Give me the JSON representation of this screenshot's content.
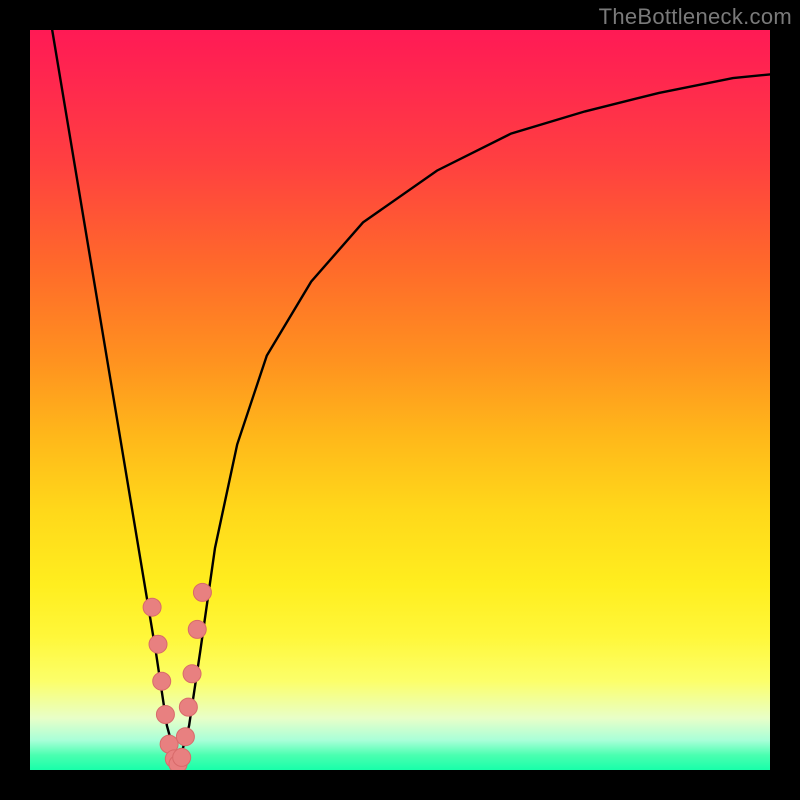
{
  "watermark": "TheBottleneck.com",
  "colors": {
    "background_frame": "#000000",
    "curve": "#000000",
    "marker_fill": "#e88080",
    "marker_stroke": "#d86a6a",
    "gradient_top": "#ff1a55",
    "gradient_mid": "#ffd81a",
    "gradient_bottom": "#18ffaa"
  },
  "chart_data": {
    "type": "line",
    "title": "",
    "xlabel": "",
    "ylabel": "",
    "xlim": [
      0,
      100
    ],
    "ylim": [
      0,
      100
    ],
    "grid": false,
    "legend": false,
    "note": "V-shaped curve: steep left descent, minimum near x≈20, convex rise to the right. Axis values are read off the plot area as percentages; the figure is unlabeled.",
    "series": [
      {
        "name": "curve",
        "x": [
          3,
          5,
          8,
          11,
          14,
          17,
          18.5,
          20,
          21.5,
          23,
          25,
          28,
          32,
          38,
          45,
          55,
          65,
          75,
          85,
          95,
          100
        ],
        "y": [
          100,
          88,
          70,
          52,
          34,
          16,
          6,
          0.5,
          6,
          16,
          30,
          44,
          56,
          66,
          74,
          81,
          86,
          89,
          91.5,
          93.5,
          94
        ]
      }
    ],
    "markers": {
      "name": "highlighted-points",
      "note": "Light-coral circular markers clustered near the trough of the V",
      "x": [
        16.5,
        17.3,
        17.8,
        18.3,
        18.8,
        19.5,
        20.0,
        20.5,
        21.0,
        21.4,
        21.9,
        22.6,
        23.3
      ],
      "y": [
        22,
        17,
        12,
        7.5,
        3.5,
        1.5,
        0.8,
        1.7,
        4.5,
        8.5,
        13,
        19,
        24
      ]
    }
  }
}
